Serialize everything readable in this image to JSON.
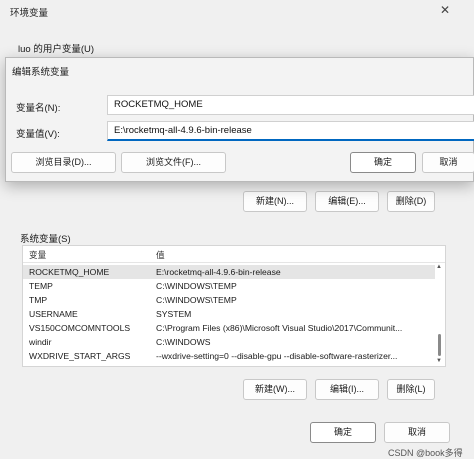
{
  "env_window": {
    "title": "环境变量",
    "close_glyph": "✕",
    "user_section_label": "luo 的用户变量(U)",
    "user_buttons": {
      "new": "新建(N)...",
      "edit": "编辑(E)...",
      "delete": "删除(D)"
    },
    "system_section_label": "系统变量(S)",
    "system_table": {
      "columns": [
        "变量",
        "值"
      ],
      "rows": [
        {
          "name": "ROCKETMQ_HOME",
          "value": "E:\\rocketmq-all-4.9.6-bin-release",
          "selected": true
        },
        {
          "name": "TEMP",
          "value": "C:\\WINDOWS\\TEMP"
        },
        {
          "name": "TMP",
          "value": "C:\\WINDOWS\\TEMP"
        },
        {
          "name": "USERNAME",
          "value": "SYSTEM"
        },
        {
          "name": "VS150COMCOMNTOOLS",
          "value": "C:\\Program Files (x86)\\Microsoft Visual Studio\\2017\\Communit..."
        },
        {
          "name": "windir",
          "value": "C:\\WINDOWS"
        },
        {
          "name": "WXDRIVE_START_ARGS",
          "value": "--wxdrive-setting=0 --disable-gpu --disable-software-rasterizer..."
        }
      ]
    },
    "system_buttons": {
      "new": "新建(W)...",
      "edit": "编辑(I)...",
      "delete": "删除(L)"
    },
    "footer_buttons": {
      "ok": "确定",
      "cancel": "取消"
    }
  },
  "edit_dialog": {
    "title": "编辑系统变量",
    "name_label": "变量名(N):",
    "name_value": "ROCKETMQ_HOME",
    "value_label": "变量值(V):",
    "value_value": "E:\\rocketmq-all-4.9.6-bin-release",
    "browse_dir": "浏览目录(D)...",
    "browse_file": "浏览文件(F)...",
    "ok": "确定",
    "cancel": "取消"
  },
  "watermark": "CSDN @book多得",
  "colors": {
    "accent": "#0067c0",
    "selected_row": "#e5e5e5"
  }
}
